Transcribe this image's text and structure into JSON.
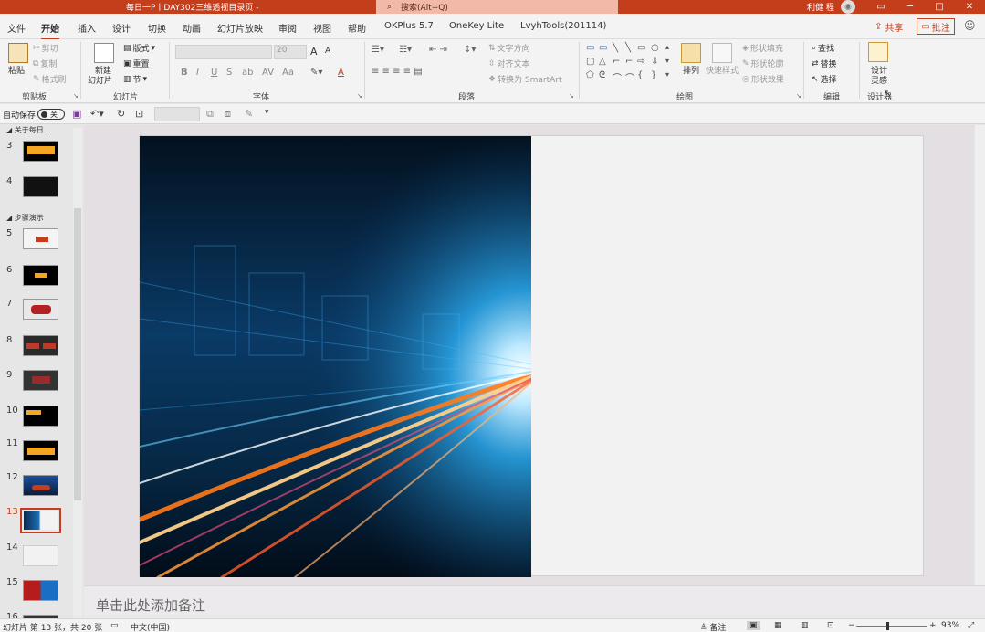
{
  "titlebar": {
    "title": "每日一P丨DAY302三维透视目录页  -",
    "search_placeholder": "搜索(Alt+Q)",
    "user": "利健 程",
    "minimize": "─",
    "restore": "□",
    "close": "✕",
    "ribbon_display": "▭"
  },
  "menu": {
    "tabs": [
      "文件",
      "开始",
      "插入",
      "设计",
      "切换",
      "动画",
      "幻灯片放映",
      "审阅",
      "视图",
      "帮助",
      "OKPlus 5.7",
      "OneKey Lite",
      "LvyhTools(201114)"
    ],
    "share": "共享",
    "comment": "批注"
  },
  "ribbon": {
    "clipboard": {
      "paste": "粘贴",
      "cut": "剪切",
      "copy": "复制",
      "format_painter": "格式刷",
      "label": "剪贴板"
    },
    "slides": {
      "new_slide_1": "新建",
      "new_slide_2": "幻灯片",
      "layout": "版式",
      "reset": "重置",
      "section": "节",
      "label": "幻灯片"
    },
    "font": {
      "label": "字体",
      "size": "20",
      "bold": "B",
      "italic": "I",
      "underline": "U",
      "strike": "S",
      "shadow": "ab",
      "spacing": "AV",
      "case": "Aa",
      "grow": "A",
      "shrink": "A"
    },
    "paragraph": {
      "label": "段落",
      "text_direction": "文字方向",
      "align_text": "对齐文本",
      "smartart": "转换为 SmartArt"
    },
    "drawing": {
      "arrange": "排列",
      "quick_styles": "快速样式",
      "shape_fill": "形状填充",
      "shape_outline": "形状轮廓",
      "shape_effects": "形状效果",
      "label": "绘图"
    },
    "editing": {
      "find": "查找",
      "replace": "替换",
      "select": "选择",
      "label": "编辑"
    },
    "designer": {
      "line1": "设计",
      "line2": "灵感",
      "label": "设计器"
    }
  },
  "qat": {
    "autosave": "自动保存",
    "toggle": "关"
  },
  "panel": {
    "sections": [
      {
        "label": "关于每日..."
      },
      {
        "label": "步骤演示"
      }
    ],
    "slides": [
      {
        "num": "3"
      },
      {
        "num": "4"
      },
      {
        "num": "5"
      },
      {
        "num": "6"
      },
      {
        "num": "7"
      },
      {
        "num": "8"
      },
      {
        "num": "9"
      },
      {
        "num": "10"
      },
      {
        "num": "11"
      },
      {
        "num": "12"
      },
      {
        "num": "13"
      },
      {
        "num": "14"
      },
      {
        "num": "15"
      },
      {
        "num": "16"
      }
    ]
  },
  "notes": {
    "placeholder": "单击此处添加备注"
  },
  "status": {
    "slide_info": "幻灯片 第 13 张，共 20 张",
    "language": "中文(中国)",
    "notes": "备注",
    "zoom_minus": "−",
    "zoom_plus": "+",
    "zoom": "93%"
  },
  "colors": {
    "accent": "#c43e1c",
    "title_bg": "#c43e1c",
    "search_bg": "#f3b9a8"
  }
}
